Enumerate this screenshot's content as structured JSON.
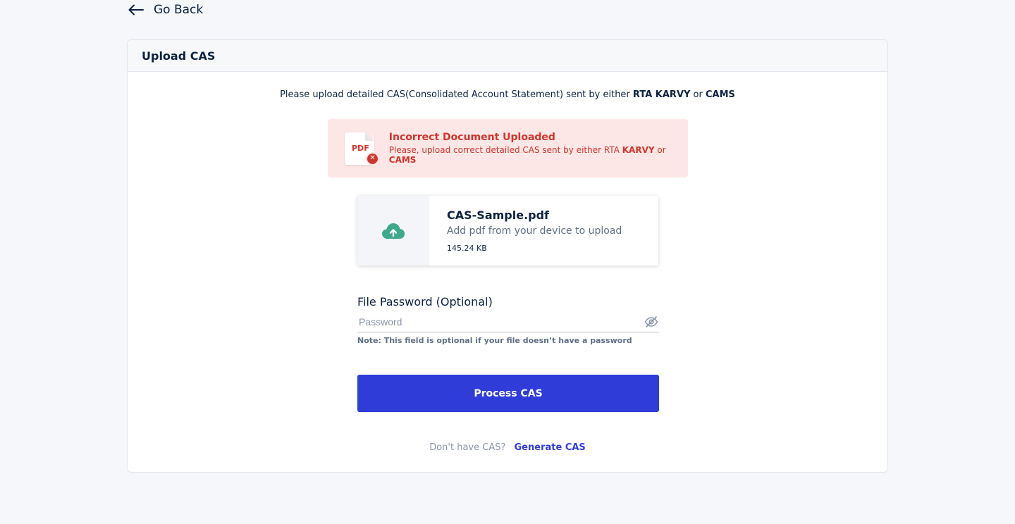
{
  "nav": {
    "back_label": "Go Back"
  },
  "card": {
    "title": "Upload CAS"
  },
  "intro": {
    "prefix": "Please upload detailed CAS(Consolidated Account Statement) sent by either ",
    "rta": "RTA KARVY",
    "or": " or ",
    "cams": "CAMS"
  },
  "error": {
    "icon_text": "PDF",
    "title": "Incorrect Document Uploaded",
    "desc_prefix": "Please, upload correct detailed CAS sent by either RTA ",
    "karvy": "KARVY",
    "or": " or ",
    "cams": "CAMS"
  },
  "file": {
    "name": "CAS-Sample.pdf",
    "hint": "Add pdf from your device to upload",
    "size": "145.24 KB",
    "icon": "cloud-upload-icon"
  },
  "password": {
    "label": "File Password (Optional)",
    "placeholder": "Password",
    "value": "",
    "note": "Note: This field is optional if your file doesn’t have a password",
    "toggle_icon": "eye-off-icon"
  },
  "actions": {
    "process_label": "Process CAS"
  },
  "footer": {
    "question": "Don't have CAS?",
    "link": "Generate CAS"
  },
  "colors": {
    "primary": "#2f3cd8",
    "error": "#d0342c",
    "error_bg": "#fde7e6",
    "upload_icon": "#3daa8c",
    "text": "#0d2240"
  }
}
